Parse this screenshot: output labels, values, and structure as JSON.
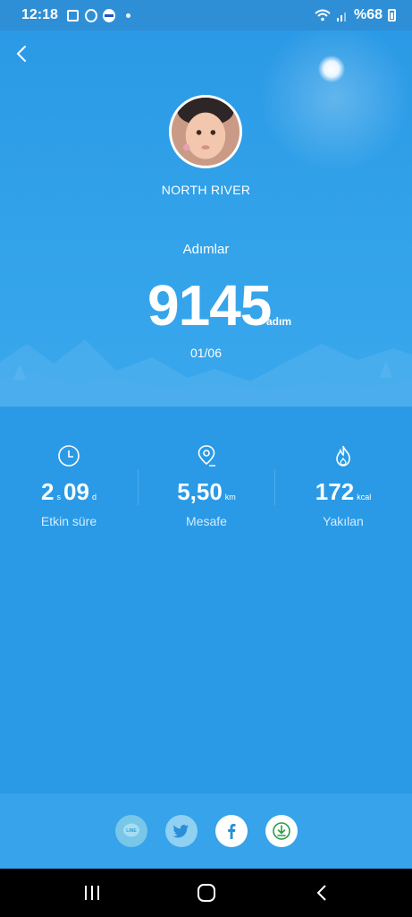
{
  "status_bar": {
    "time": "12:18",
    "battery": "%68",
    "icons": [
      "notes-icon",
      "whatsapp-icon",
      "app-icon",
      "dot-icon",
      "wifi-icon",
      "signal-icon",
      "battery-icon"
    ]
  },
  "header": {
    "back_icon": "chevron-left-icon"
  },
  "profile": {
    "name": "NORTH RIVER"
  },
  "steps": {
    "label": "Adımlar",
    "value": "9145",
    "unit": "adım",
    "date": "01/06"
  },
  "stats": [
    {
      "icon": "clock-icon",
      "value_main": "2",
      "value_sub": "s",
      "value_rest": "09",
      "unit": "d",
      "label": "Etkin süre"
    },
    {
      "icon": "location-icon",
      "value_main": "5,50",
      "unit": "km",
      "label": "Mesafe"
    },
    {
      "icon": "flame-icon",
      "value_main": "172",
      "unit": "kcal",
      "label": "Yakılan"
    }
  ],
  "share": {
    "buttons": [
      {
        "name": "line",
        "label": "LINE",
        "color": "#78c6e8",
        "icon": "line-icon"
      },
      {
        "name": "twitter",
        "color": "#8fd0f3",
        "icon": "twitter-icon"
      },
      {
        "name": "facebook",
        "color": "#ffffff",
        "icon": "facebook-icon"
      },
      {
        "name": "download",
        "color": "#ffffff",
        "icon": "download-icon"
      }
    ]
  },
  "nav": {
    "icons": [
      "recent-apps-icon",
      "home-icon",
      "back-icon"
    ]
  },
  "colors": {
    "background": "#2a9ae6",
    "share_bar": "#36a3ea",
    "text": "#ffffff",
    "label": "#d3ecff"
  }
}
